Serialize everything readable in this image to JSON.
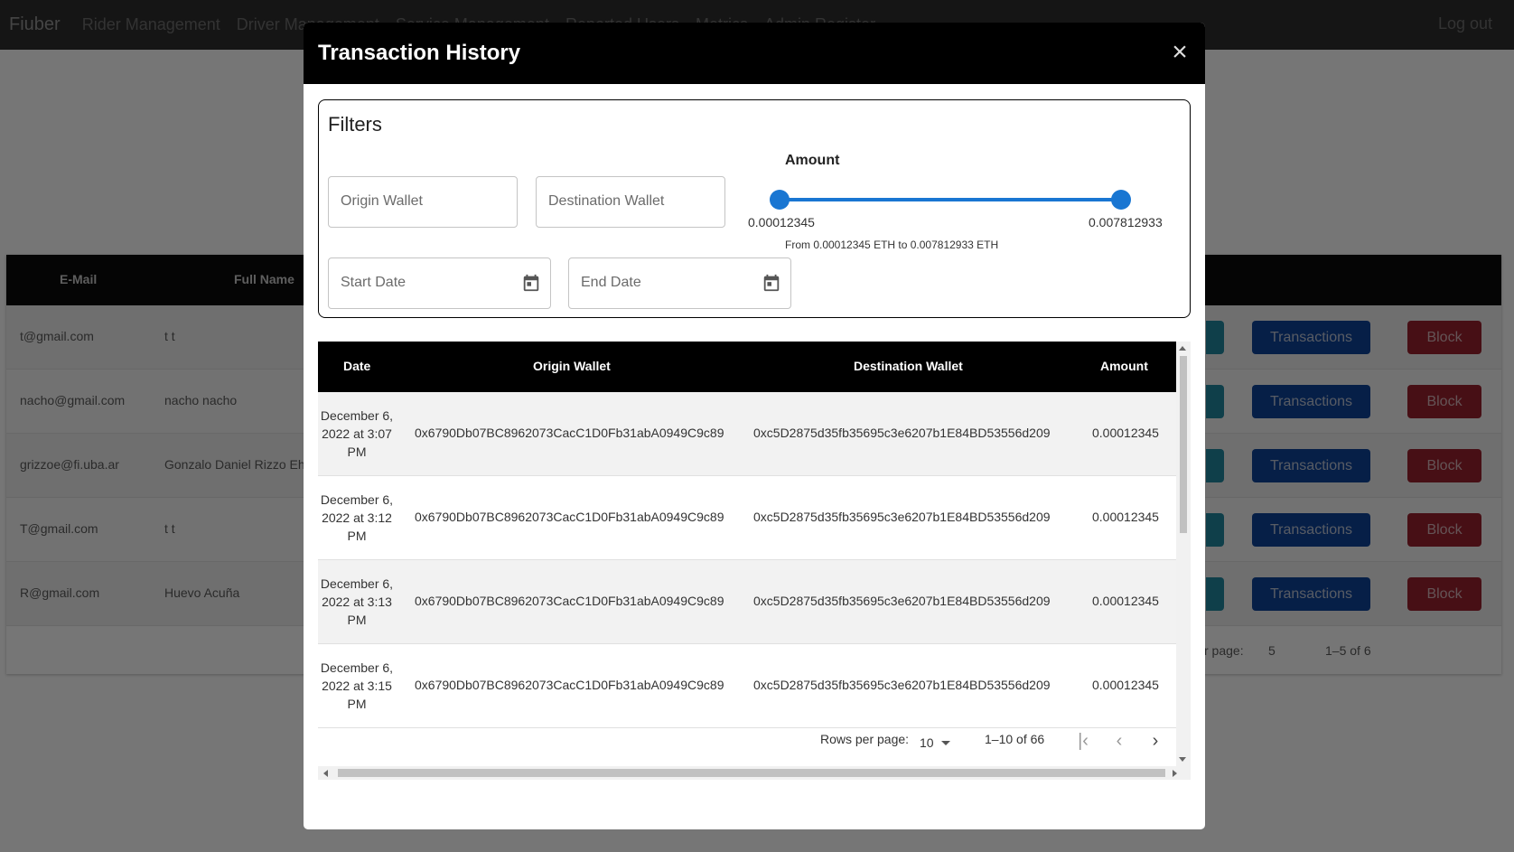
{
  "app": {
    "brand": "Fiuber",
    "nav": [
      "Rider Management",
      "Driver Management",
      "Service Management",
      "Reported Users",
      "Metrics",
      "Admin Register"
    ],
    "logout": "Log out"
  },
  "background_table": {
    "headers": [
      "E-Mail",
      "Full Name"
    ],
    "rows": [
      {
        "email": "t@gmail.com",
        "name": "t t"
      },
      {
        "email": "nacho@gmail.com",
        "name": "nacho nacho"
      },
      {
        "email": "grizzoe@fi.uba.ar",
        "name": "Gonzalo Daniel Rizzo Eh"
      },
      {
        "email": "T@gmail.com",
        "name": "t t"
      },
      {
        "email": "R@gmail.com",
        "name": "Huevo Acuña"
      }
    ],
    "transactions_label": "Transactions",
    "block_label": "Block",
    "footer_rpp_label": "r page:",
    "footer_rpp_value": "5",
    "footer_count": "1–5 of 6"
  },
  "modal": {
    "title": "Transaction History",
    "close_icon": "close-icon",
    "filters": {
      "title": "Filters",
      "origin_placeholder": "Origin Wallet",
      "destination_placeholder": "Destination Wallet",
      "start_date_placeholder": "Start Date",
      "end_date_placeholder": "End Date",
      "amount_label": "Amount",
      "min_value": "0.00012345",
      "max_value": "0.007812933",
      "range_text": "From 0.00012345 ETH to 0.007812933 ETH"
    },
    "table": {
      "headers": {
        "date": "Date",
        "origin": "Origin Wallet",
        "destination": "Destination Wallet",
        "amount": "Amount"
      },
      "rows": [
        {
          "date": "December 6, 2022 at 3:07 PM",
          "origin": "0x6790Db07BC8962073CacC1D0Fb31abA0949C9c89",
          "destination": "0xc5D2875d35fb35695c3e6207b1E84BD53556d209",
          "amount": "0.00012345"
        },
        {
          "date": "December 6, 2022 at 3:12 PM",
          "origin": "0x6790Db07BC8962073CacC1D0Fb31abA0949C9c89",
          "destination": "0xc5D2875d35fb35695c3e6207b1E84BD53556d209",
          "amount": "0.00012345"
        },
        {
          "date": "December 6, 2022 at 3:13 PM",
          "origin": "0x6790Db07BC8962073CacC1D0Fb31abA0949C9c89",
          "destination": "0xc5D2875d35fb35695c3e6207b1E84BD53556d209",
          "amount": "0.00012345"
        },
        {
          "date": "December 6, 2022 at 3:15 PM",
          "origin": "0x6790Db07BC8962073CacC1D0Fb31abA0949C9c89",
          "destination": "0xc5D2875d35fb35695c3e6207b1E84BD53556d209",
          "amount": "0.00012345"
        }
      ]
    },
    "pagination": {
      "rows_per_page_label": "Rows per page:",
      "rows_per_page_value": "10",
      "count": "1–10 of 66"
    }
  }
}
